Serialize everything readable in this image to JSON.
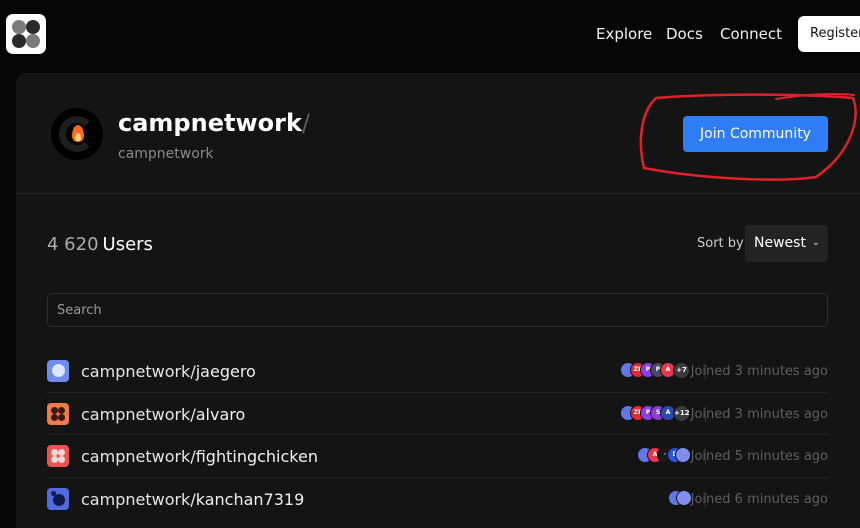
{
  "nav": {
    "links": [
      "Explore",
      "Docs",
      "Connect"
    ],
    "register_label": "Register"
  },
  "community": {
    "name": "campnetwork",
    "slash": "/",
    "handle": "campnetwork",
    "join_label": "Join Community"
  },
  "users": {
    "count": "4 620",
    "label": "Users"
  },
  "sort": {
    "label": "Sort by",
    "value": "Newest"
  },
  "search": {
    "placeholder": "Search"
  },
  "list": [
    {
      "prefix": "campnetwork/",
      "username": "jaegero",
      "joined": "Joined 3 minutes ago",
      "avatar_colors": [
        "#6e8cf0",
        "#cfd8ff"
      ],
      "badges": [
        {
          "color": "#5f78e8",
          "text": ""
        },
        {
          "color": "#e8262f",
          "text": "ZP"
        },
        {
          "color": "#8d3df0",
          "text": "P"
        },
        {
          "color": "#4a4a66",
          "text": "P"
        },
        {
          "color": "#e8374a",
          "text": "A"
        },
        {
          "color": "#3c3c3c",
          "text": "+7",
          "more": true
        }
      ]
    },
    {
      "prefix": "campnetwork/",
      "username": "alvaro",
      "joined": "Joined 3 minutes ago",
      "avatar_colors": [
        "#f07a4a",
        "#3a1a0e"
      ],
      "badges": [
        {
          "color": "#5f78e8",
          "text": ""
        },
        {
          "color": "#e8262f",
          "text": "ZP"
        },
        {
          "color": "#8d3df0",
          "text": "P"
        },
        {
          "color": "#8a3dd0",
          "text": "S"
        },
        {
          "color": "#2a4bb0",
          "text": "A"
        },
        {
          "color": "#3c3c3c",
          "text": "+12",
          "more": true
        }
      ]
    },
    {
      "prefix": "campnetwork/",
      "username": "fightingchicken",
      "joined": "Joined 5 minutes ago",
      "avatar_colors": [
        "#f05050",
        "#ffd6d6"
      ],
      "badges": [
        {
          "color": "#5f78e8",
          "text": ""
        },
        {
          "color": "#e8374a",
          "text": "A"
        },
        {
          "color": "#1a1a1a",
          "text": "·"
        },
        {
          "color": "#2a55e0",
          "text": "D"
        },
        {
          "color": "#7f8ef0",
          "text": ""
        }
      ]
    },
    {
      "prefix": "campnetwork/",
      "username": "kanchan7319",
      "joined": "Joined 6 minutes ago",
      "avatar_colors": [
        "#4f6be0",
        "#0d1a4a"
      ],
      "badges": [
        {
          "color": "#5f78e8",
          "text": ""
        },
        {
          "color": "#7f8ef0",
          "text": ""
        }
      ]
    }
  ]
}
